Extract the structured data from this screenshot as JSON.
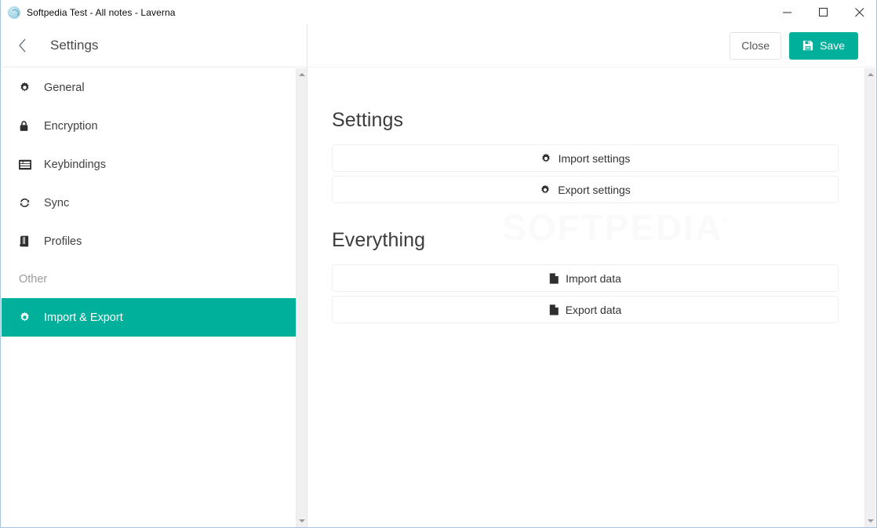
{
  "window": {
    "title": "Softpedia Test - All notes - Laverna",
    "app_icon": "laverna-app-icon",
    "controls": {
      "minimize": "minimize-icon",
      "maximize": "maximize-icon",
      "close": "close-icon"
    }
  },
  "settings_header": {
    "back_icon": "chevron-left-icon",
    "title": "Settings"
  },
  "action_bar": {
    "close_label": "Close",
    "save_label": "Save",
    "save_icon": "floppy-save-icon"
  },
  "sidebar": {
    "items": [
      {
        "label": "General",
        "icon": "gear-icon"
      },
      {
        "label": "Encryption",
        "icon": "lock-icon"
      },
      {
        "label": "Keybindings",
        "icon": "keyboard-list-icon"
      },
      {
        "label": "Sync",
        "icon": "sync-refresh-icon"
      },
      {
        "label": "Profiles",
        "icon": "book-icon"
      }
    ],
    "section_label": "Other",
    "active_item": {
      "label": "Import & Export",
      "icon": "gear-icon"
    },
    "scrollbar": {
      "up_arrow": "scroll-up-arrow",
      "down_arrow": "scroll-down-arrow"
    }
  },
  "content": {
    "sections": [
      {
        "title": "Settings",
        "buttons": [
          {
            "label": "Import settings",
            "icon": "gear-icon"
          },
          {
            "label": "Export settings",
            "icon": "gear-icon"
          }
        ]
      },
      {
        "title": "Everything",
        "buttons": [
          {
            "label": "Import data",
            "icon": "file-icon"
          },
          {
            "label": "Export data",
            "icon": "file-icon"
          }
        ]
      }
    ],
    "watermark": "SOFTPEDIA",
    "watermark_mark": "°",
    "scrollbar": {
      "up_arrow": "scroll-up-arrow",
      "down_arrow": "scroll-down-arrow"
    }
  },
  "colors": {
    "accent": "#00b09b",
    "window_border": "#a9c3e3",
    "text": "#3f3f3f",
    "muted": "#9b9b9b"
  }
}
